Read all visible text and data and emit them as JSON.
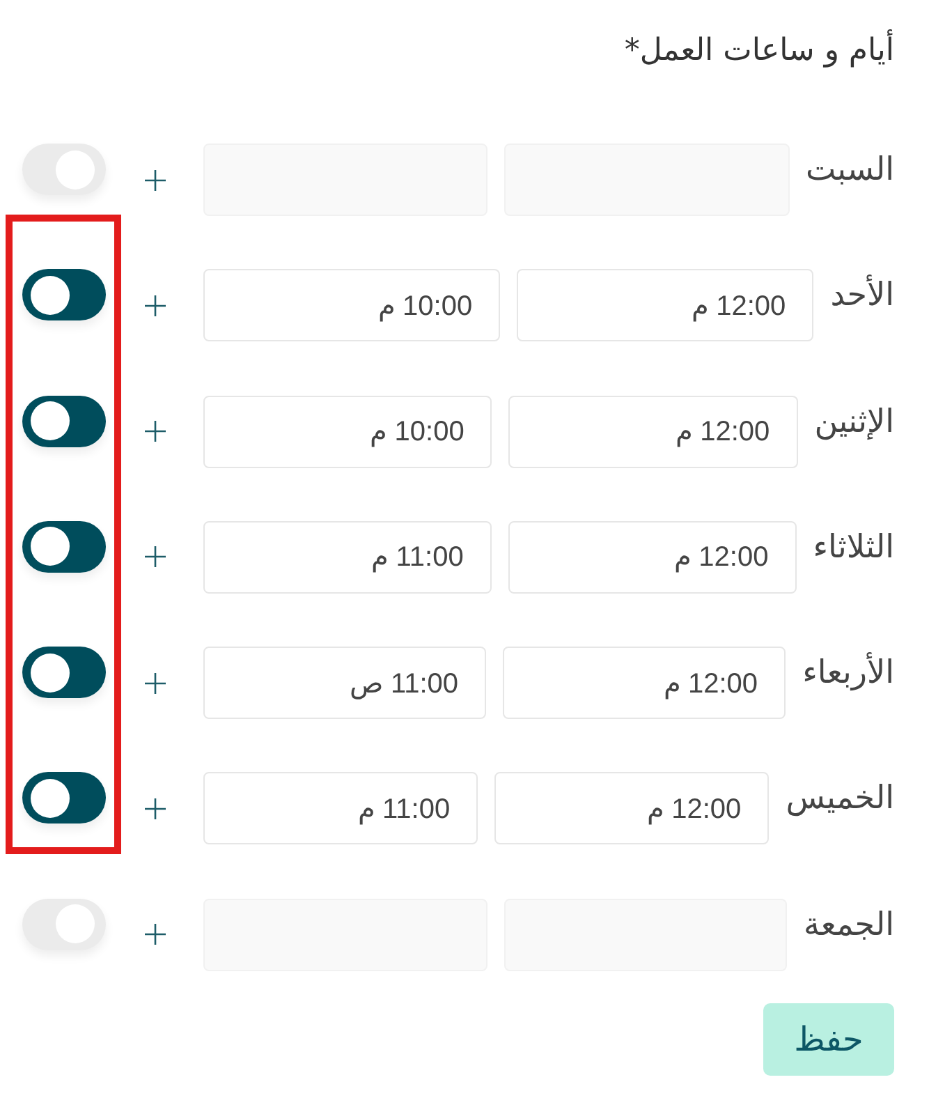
{
  "section": {
    "title": "أيام و ساعات العمل*"
  },
  "days": [
    {
      "name": "السبت",
      "enabled": false,
      "highlighted": false
    },
    {
      "name": "الأحد",
      "enabled": true,
      "highlighted": true,
      "start": "12:00 م",
      "end": "10:00 م"
    },
    {
      "name": "الإثنين",
      "enabled": true,
      "highlighted": true,
      "start": "12:00 م",
      "end": "10:00 م"
    },
    {
      "name": "الثلاثاء",
      "enabled": true,
      "highlighted": true,
      "start": "12:00 م",
      "end": "11:00 م"
    },
    {
      "name": "الأربعاء",
      "enabled": true,
      "highlighted": true,
      "start": "12:00 م",
      "end": "11:00 ص"
    },
    {
      "name": "الخميس",
      "enabled": true,
      "highlighted": true,
      "start": "12:00 م",
      "end": "11:00 م"
    },
    {
      "name": "الجمعة",
      "enabled": false,
      "highlighted": false
    }
  ],
  "save_button": {
    "label": "حفظ"
  }
}
